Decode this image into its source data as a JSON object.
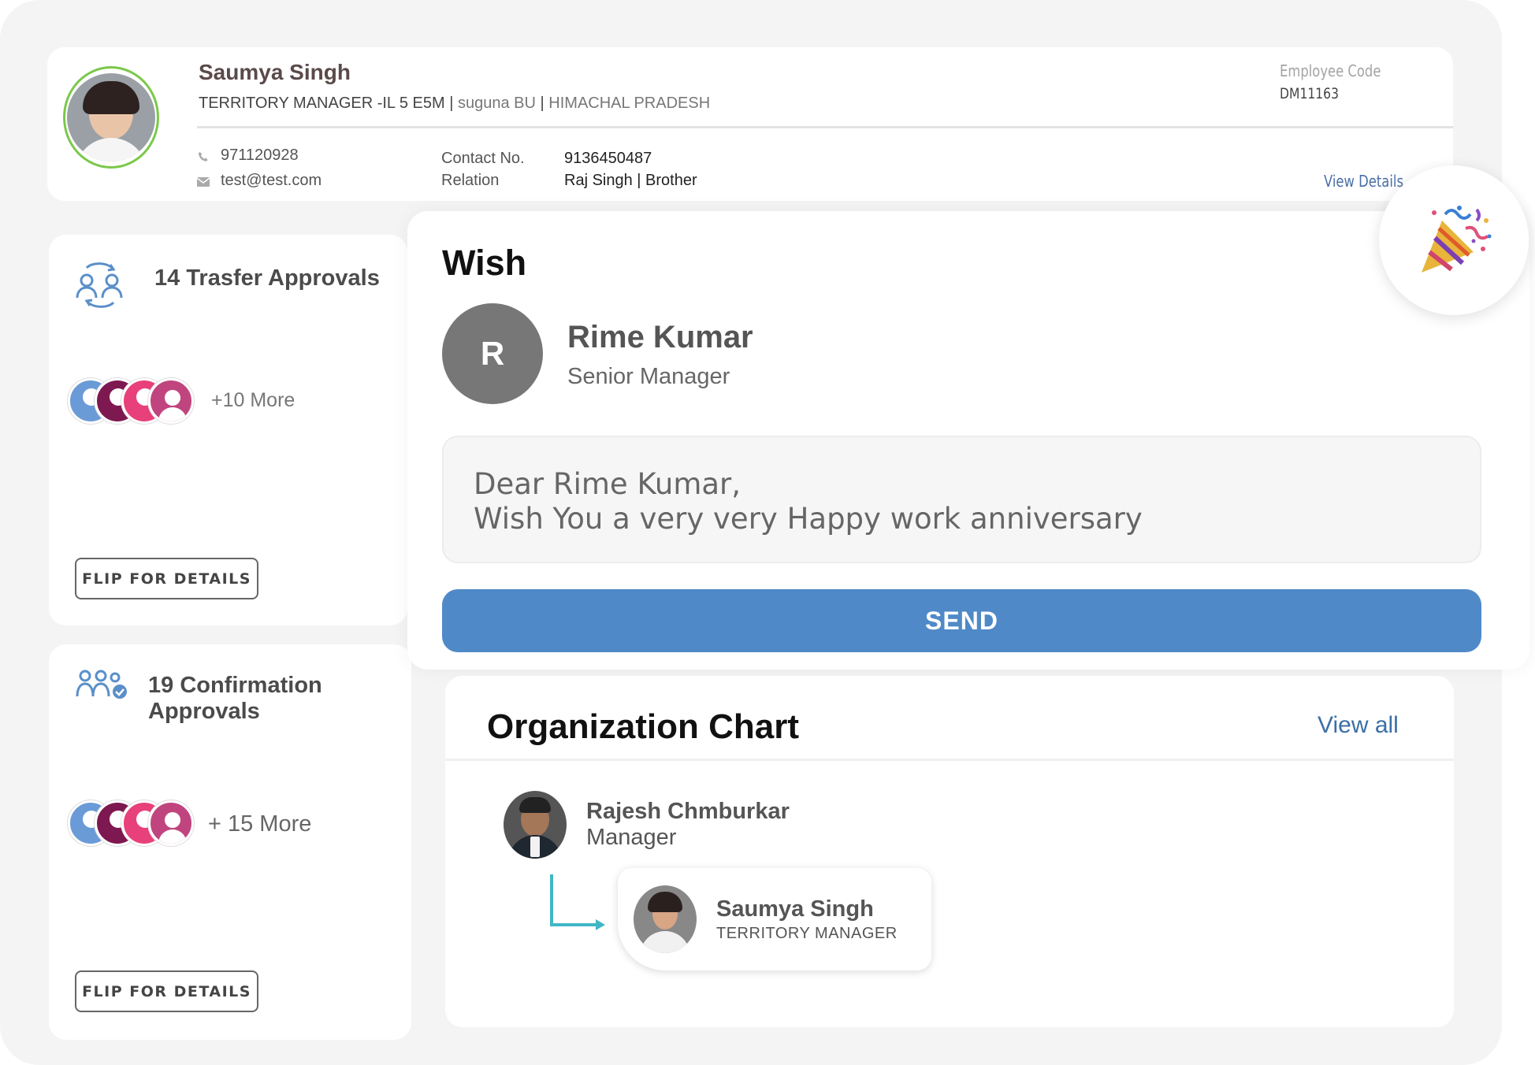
{
  "profile": {
    "name": "Saumya Singh",
    "designation": "TERRITORY MANAGER -IL 5 E5M",
    "bu": "suguna BU",
    "location": "HIMACHAL PRADESH",
    "employee_code_label": "Employee Code",
    "employee_code": "DM11163",
    "phone": "971120928",
    "email": "test@test.com",
    "contact_label": "Contact No.",
    "contact_value": "9136450487",
    "relation_label": "Relation",
    "relation_name": "Raj Singh",
    "relation_type": "Brother",
    "view_details": "View Details"
  },
  "approvals": [
    {
      "title": "14 Trasfer Approvals",
      "more": "+10 More",
      "flip": "FLIP FOR DETAILS",
      "icon": "people-transfer-icon"
    },
    {
      "title": "19 Confirmation Approvals",
      "more": "+ 15 More",
      "flip": "FLIP FOR DETAILS",
      "icon": "people-confirm-icon"
    }
  ],
  "wish": {
    "title": "Wish",
    "initial": "R",
    "recipient_name": "Rime Kumar",
    "recipient_role": "Senior Manager",
    "message_line1": "Dear Rime Kumar,",
    "message_line2": "Wish You a very very Happy work anniversary",
    "send_label": "SEND",
    "icon": "party-popper-icon"
  },
  "org_chart": {
    "title": "Organization Chart",
    "view_all": "View all",
    "manager": {
      "name": "Rajesh Chmburkar",
      "role": "Manager"
    },
    "self": {
      "name": "Saumya Singh",
      "role": "TERRITORY MANAGER"
    }
  },
  "colors": {
    "accent_blue": "#4f89c8",
    "link_blue": "#3a6fa5",
    "avatar_ring": "#7bc84a",
    "connector": "#3fb7c6"
  }
}
